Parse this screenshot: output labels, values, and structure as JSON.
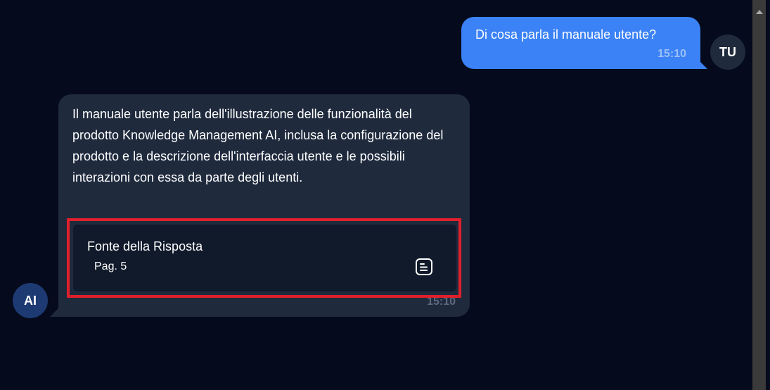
{
  "messages": {
    "user": {
      "text": "Di cosa parla il manuale utente?",
      "time": "15:10",
      "avatar": "TU",
      "bubble_color": "#3b82f6"
    },
    "ai": {
      "text": "Il manuale utente parla dell'illustrazione delle funzionalità del prodotto Knowledge Management AI, inclusa la configurazione del prodotto e la descrizione dell'interfaccia utente e le possibili interazioni con essa da parte degli utenti.",
      "time": "15:10",
      "avatar": "AI",
      "bubble_color": "#1f2a3d",
      "source": {
        "title": "Fonte della Risposta",
        "page": "Pag. 5",
        "icon": "document-icon"
      }
    }
  },
  "colors": {
    "background": "#050a1c",
    "highlight": "#e0202a"
  }
}
